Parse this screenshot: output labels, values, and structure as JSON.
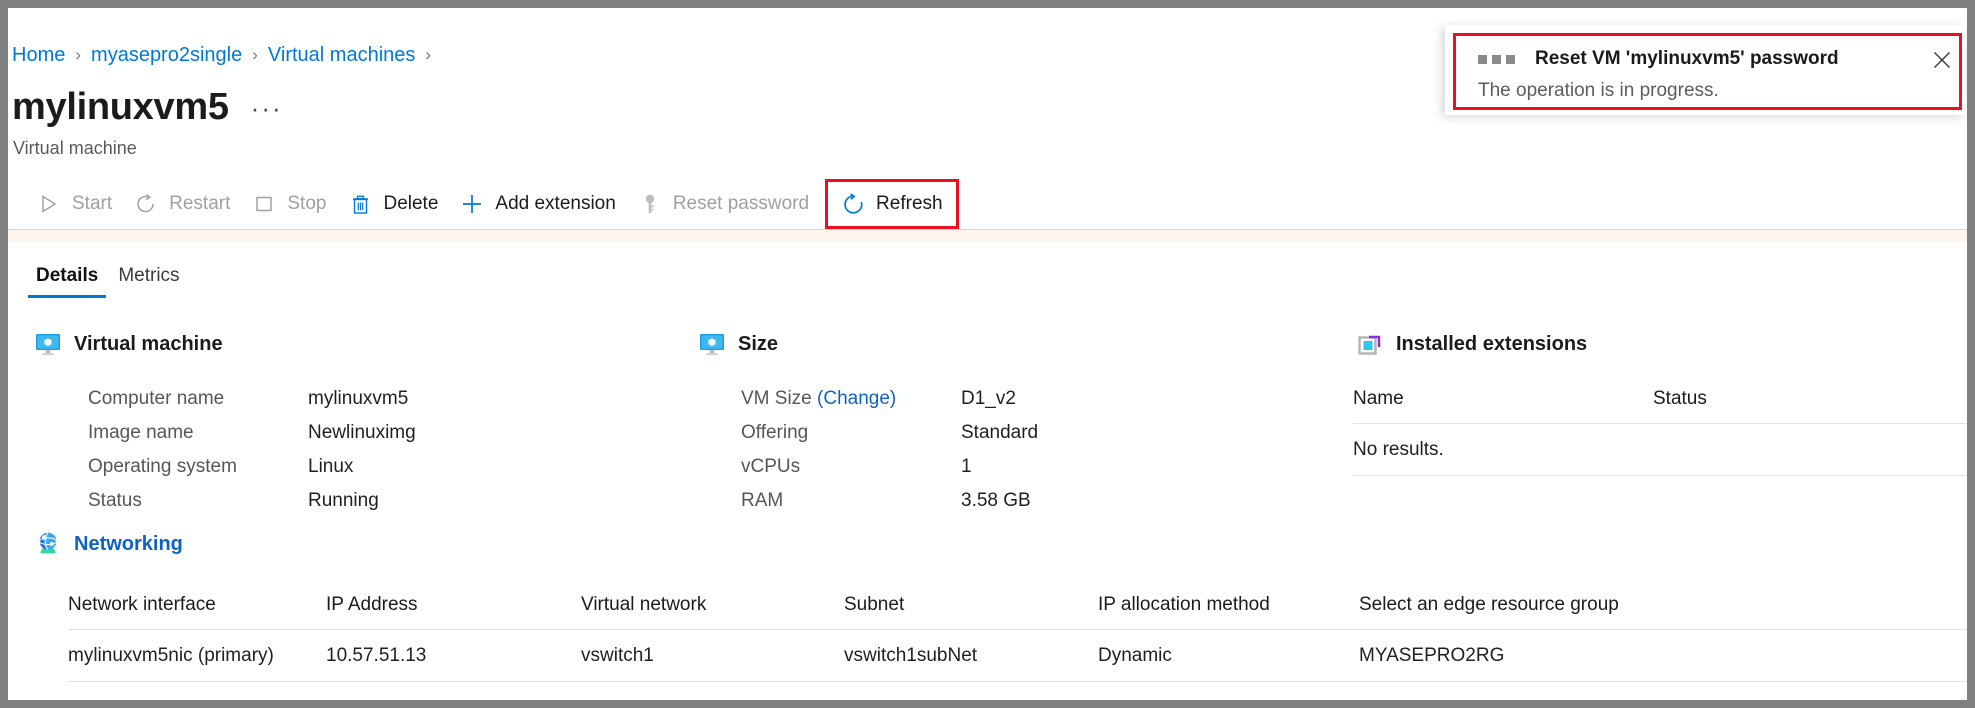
{
  "breadcrumb": {
    "items": [
      {
        "label": "Home"
      },
      {
        "label": "myasepro2single"
      },
      {
        "label": "Virtual machines"
      }
    ],
    "separator": "›"
  },
  "header": {
    "title": "mylinuxvm5",
    "ellipsis": "···",
    "subtitle": "Virtual machine"
  },
  "toolbar": {
    "buttons": [
      {
        "label": "Start",
        "icon": "play-icon",
        "disabled": true
      },
      {
        "label": "Restart",
        "icon": "restart-icon",
        "disabled": true
      },
      {
        "label": "Stop",
        "icon": "stop-square-icon",
        "disabled": true
      },
      {
        "label": "Delete",
        "icon": "trash-icon",
        "disabled": false
      },
      {
        "label": "Add extension",
        "icon": "plus-icon",
        "disabled": false
      },
      {
        "label": "Reset password",
        "icon": "key-icon",
        "disabled": true
      },
      {
        "label": "Refresh",
        "icon": "refresh-icon",
        "disabled": false,
        "highlighted": true
      }
    ]
  },
  "tabs": [
    {
      "label": "Details",
      "active": true
    },
    {
      "label": "Metrics",
      "active": false
    }
  ],
  "sections": {
    "virtual_machine": {
      "title": "Virtual machine",
      "icon": "virtual-machine-icon",
      "rows": [
        {
          "key": "Computer name",
          "value": "mylinuxvm5"
        },
        {
          "key": "Image name",
          "value": "Newlinuximg"
        },
        {
          "key": "Operating system",
          "value": "Linux"
        },
        {
          "key": "Status",
          "value": "Running"
        }
      ]
    },
    "size": {
      "title": "Size",
      "icon": "size-icon",
      "rows": [
        {
          "key": "VM Size ",
          "link": "(Change)",
          "value": "D1_v2"
        },
        {
          "key": "Offering",
          "value": "Standard"
        },
        {
          "key": "vCPUs",
          "value": "1"
        },
        {
          "key": "RAM",
          "value": "3.58 GB"
        }
      ]
    },
    "installed_extensions": {
      "title": "Installed extensions",
      "icon": "extensions-icon",
      "columns": [
        "Name",
        "Status"
      ],
      "empty_text": "No results."
    },
    "networking": {
      "title": "Networking",
      "icon": "networking-icon",
      "columns": [
        "Network interface",
        "IP Address",
        "Virtual network",
        "Subnet",
        "IP allocation method",
        "Select an edge resource group"
      ],
      "rows": [
        [
          "mylinuxvm5nic (primary)",
          "10.57.51.13",
          "vswitch1",
          "vswitch1subNet",
          "Dynamic",
          "MYASEPRO2RG"
        ]
      ]
    }
  },
  "notification": {
    "title": "Reset VM 'mylinuxvm5' password",
    "body": "The operation is in progress.",
    "close_label": "✕"
  },
  "colors": {
    "accent": "#0078d4",
    "link": "#0f62c4",
    "highlight": "#e81123",
    "disabled_text": "#a0a0a0"
  }
}
